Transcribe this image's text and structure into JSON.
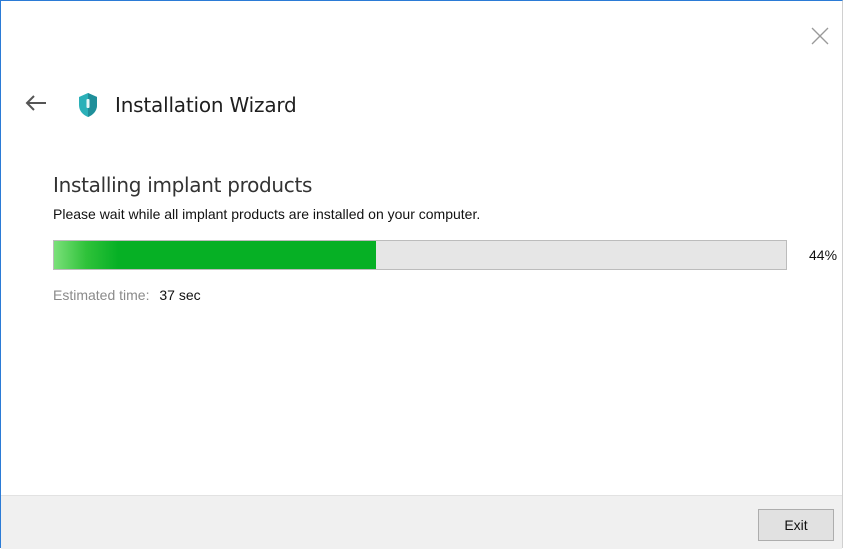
{
  "window": {
    "title": "Installation Wizard",
    "accent_color": "#2b7bd6"
  },
  "icons": {
    "close": "close-icon",
    "back": "back-arrow-icon",
    "app": "shield-app-icon"
  },
  "main": {
    "heading": "Installing implant products",
    "subtitle": "Please wait while all implant products are installed on your computer."
  },
  "progress": {
    "value": 44,
    "label": "44%",
    "color": "#06b025"
  },
  "eta": {
    "label": "Estimated time:",
    "value": "37 sec"
  },
  "footer": {
    "exit_label": "Exit"
  }
}
